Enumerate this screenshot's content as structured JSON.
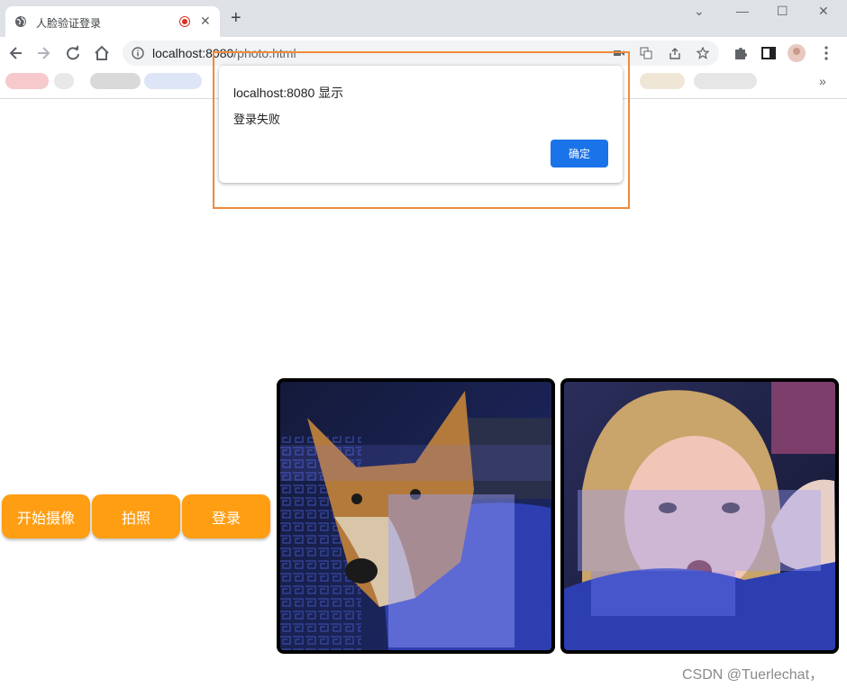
{
  "browser": {
    "tab_title": "人脸验证登录",
    "url_host": "localhost:8080",
    "url_path": "/photo.html"
  },
  "dialog": {
    "title": "localhost:8080 显示",
    "message": "登录失败",
    "ok_label": "确定"
  },
  "controls": {
    "start_camera_label": "开始摄像",
    "capture_label": "拍照",
    "login_label": "登录"
  },
  "media": {
    "live_video_desc": "camera-feed",
    "captured_photo_desc": "captured-photo"
  },
  "watermark": "CSDN @Tuerlechat，",
  "colors": {
    "accent_button": "#ff9e13",
    "dialog_ok": "#1a73e8",
    "highlight_border": "#ef8a3c"
  }
}
